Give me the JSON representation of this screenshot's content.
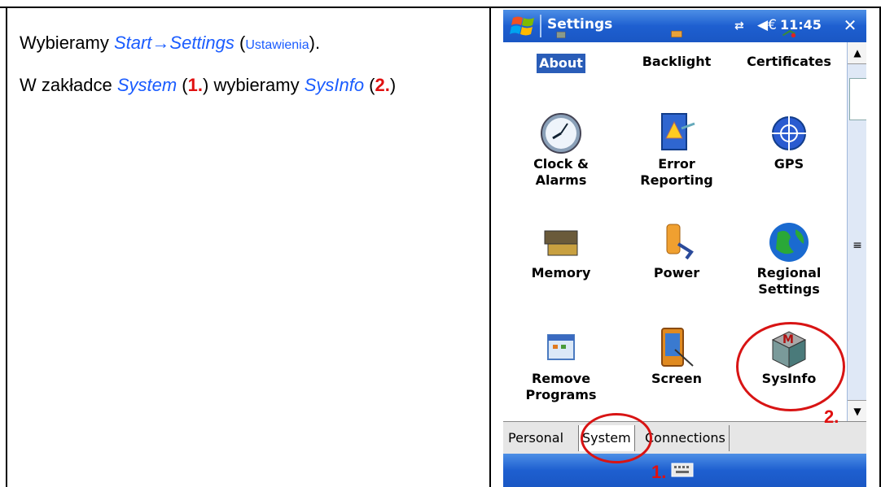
{
  "instructions": {
    "p1_prefix": "Wybieramy ",
    "p1_start": "Start",
    "p1_arrow": "→",
    "p1_settings": "Settings",
    "p1_space": " (",
    "p1_paren_text": "Ustawienia",
    "p1_suffix": ").",
    "p2_prefix": "W zakładce ",
    "p2_system": "System",
    "p2_open": " (",
    "p2_num1": "1.",
    "p2_close": ") wybieramy ",
    "p2_sysinfo": "SysInfo",
    "p2_open2": " (",
    "p2_num2": "2.",
    "p2_close2": ")"
  },
  "device": {
    "title": "Settings",
    "clock": "11:45",
    "close": "✕",
    "items": [
      {
        "label": "About",
        "icon": "about-icon"
      },
      {
        "label": "Backlight",
        "icon": "backlight-icon"
      },
      {
        "label": "Certificates",
        "icon": "certificates-icon"
      },
      {
        "label": "Clock &\nAlarms",
        "icon": "clock-icon"
      },
      {
        "label": "Error\nReporting",
        "icon": "error-reporting-icon"
      },
      {
        "label": "GPS",
        "icon": "gps-icon"
      },
      {
        "label": "Memory",
        "icon": "memory-icon"
      },
      {
        "label": "Power",
        "icon": "power-icon"
      },
      {
        "label": "Regional\nSettings",
        "icon": "globe-icon"
      },
      {
        "label": "Remove\nPrograms",
        "icon": "remove-programs-icon"
      },
      {
        "label": "Screen",
        "icon": "screen-icon"
      },
      {
        "label": "SysInfo",
        "icon": "sysinfo-icon"
      }
    ],
    "tabs": [
      "Personal",
      "System",
      "Connections"
    ],
    "active_tab": "System"
  },
  "annotations": {
    "one": "1.",
    "two": "2."
  },
  "colors": {
    "accent_blue": "#1a5cff",
    "annotation_red": "#e01010",
    "titlebar": "#1e5fd0"
  }
}
